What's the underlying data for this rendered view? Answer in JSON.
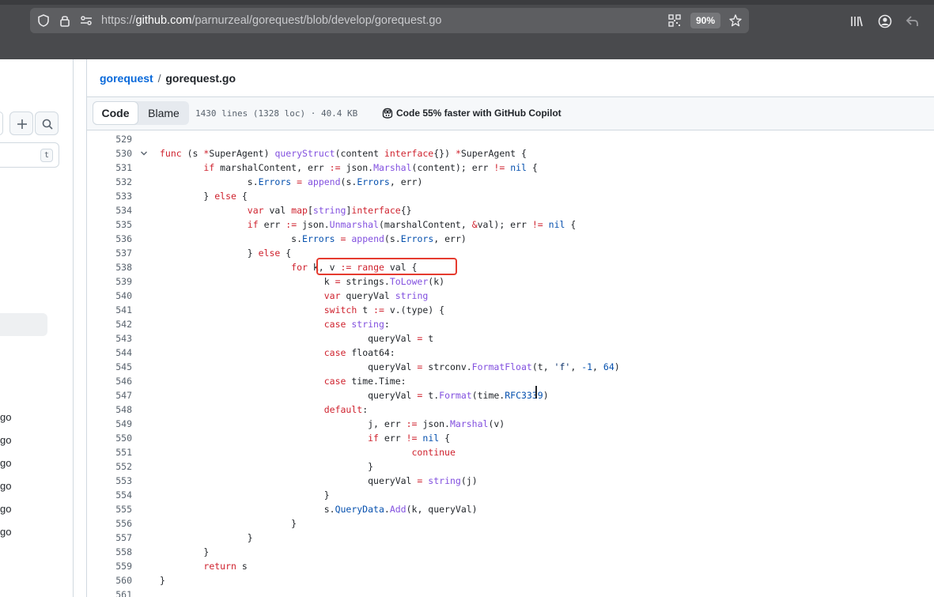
{
  "browser": {
    "url_prefix": "https://",
    "url_host": "github.com",
    "url_path": "/parnurzeal/gorequest/blob/develop/gorequest.go",
    "zoom": "90%"
  },
  "sidebar": {
    "filter_shortcut": "t",
    "files": [
      "go",
      "go",
      "go",
      "go",
      "go",
      "go"
    ]
  },
  "breadcrumb": {
    "repo": "gorequest",
    "separator": "/",
    "file": "gorequest.go"
  },
  "code_header": {
    "code_tab": "Code",
    "blame_tab": "Blame",
    "file_info": "1430 lines (1328 loc) · 40.4 KB",
    "copilot_promo": "Code 55% faster with GitHub Copilot"
  },
  "code_lines": [
    {
      "num": "529",
      "text": ""
    },
    {
      "num": "530",
      "text": "func (s *SuperAgent) queryStruct(content interface{}) *SuperAgent {"
    },
    {
      "num": "531",
      "text": "        if marshalContent, err := json.Marshal(content); err != nil {"
    },
    {
      "num": "532",
      "text": "                s.Errors = append(s.Errors, err)"
    },
    {
      "num": "533",
      "text": "        } else {"
    },
    {
      "num": "534",
      "text": "                var val map[string]interface{}"
    },
    {
      "num": "535",
      "text": "                if err := json.Unmarshal(marshalContent, &val); err != nil {"
    },
    {
      "num": "536",
      "text": "                        s.Errors = append(s.Errors, err)"
    },
    {
      "num": "537",
      "text": "                } else {"
    },
    {
      "num": "538",
      "text": "                        for k, v := range val {"
    },
    {
      "num": "539",
      "text": "                              k = strings.ToLower(k)"
    },
    {
      "num": "540",
      "text": "                              var queryVal string"
    },
    {
      "num": "541",
      "text": "                              switch t := v.(type) {"
    },
    {
      "num": "542",
      "text": "                              case string:"
    },
    {
      "num": "543",
      "text": "                                      queryVal = t"
    },
    {
      "num": "544",
      "text": "                              case float64:"
    },
    {
      "num": "545",
      "text": "                                      queryVal = strconv.FormatFloat(t, 'f', -1, 64)"
    },
    {
      "num": "546",
      "text": "                              case time.Time:"
    },
    {
      "num": "547",
      "text": "                                      queryVal = t.Format(time.RFC3339)"
    },
    {
      "num": "548",
      "text": "                              default:"
    },
    {
      "num": "549",
      "text": "                                      j, err := json.Marshal(v)"
    },
    {
      "num": "550",
      "text": "                                      if err != nil {"
    },
    {
      "num": "551",
      "text": "                                              continue"
    },
    {
      "num": "552",
      "text": "                                      }"
    },
    {
      "num": "553",
      "text": "                                      queryVal = string(j)"
    },
    {
      "num": "554",
      "text": "                              }"
    },
    {
      "num": "555",
      "text": "                              s.QueryData.Add(k, queryVal)"
    },
    {
      "num": "556",
      "text": "                        }"
    },
    {
      "num": "557",
      "text": "                }"
    },
    {
      "num": "558",
      "text": "        }"
    },
    {
      "num": "559",
      "text": "        return s"
    },
    {
      "num": "560",
      "text": "}"
    },
    {
      "num": "561",
      "text": ""
    }
  ],
  "colors": {
    "keyword": "#cf222e",
    "function": "#8250df",
    "constant": "#0550ae",
    "highlight_box": "#e53b2f",
    "link": "#0969da"
  },
  "icons": [
    "shield-icon",
    "lock-icon",
    "permissions-icon",
    "qr-code-icon",
    "star-icon",
    "library-icon",
    "account-icon",
    "back-icon",
    "plus-icon",
    "search-icon",
    "chevron-down-icon",
    "copilot-icon"
  ]
}
